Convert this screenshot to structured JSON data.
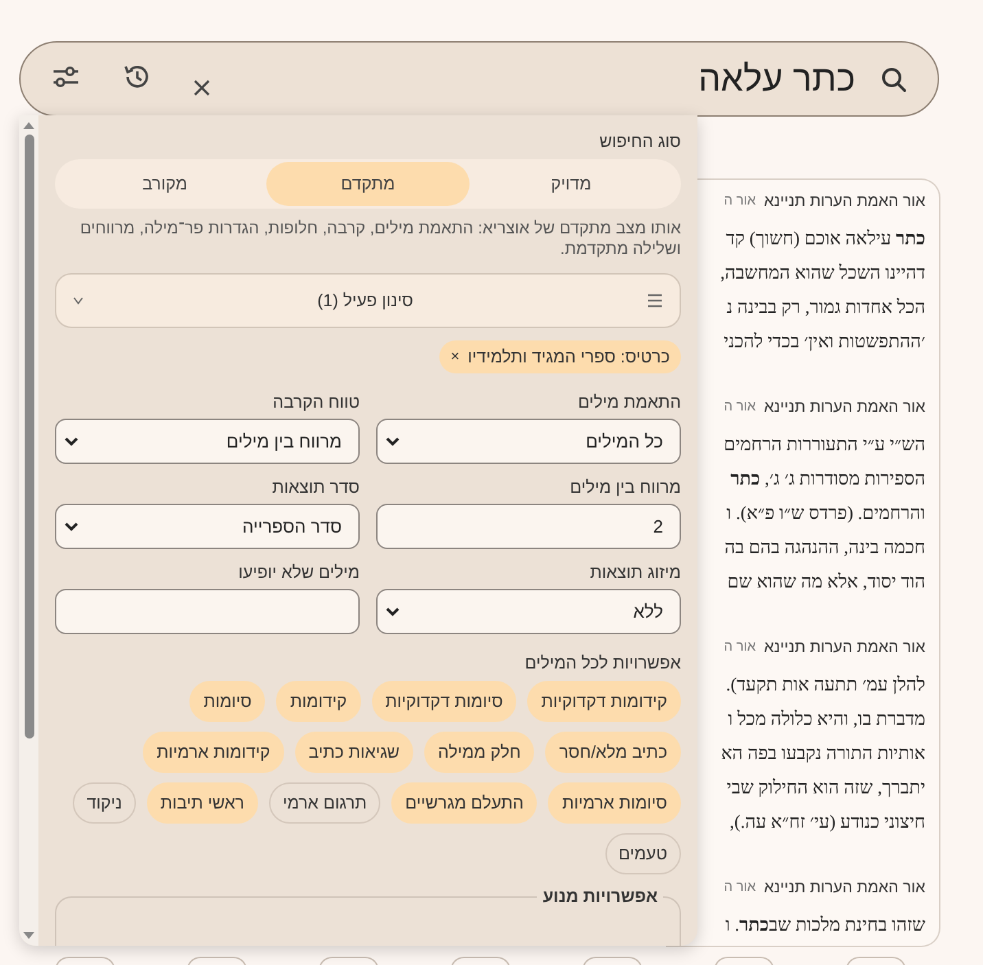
{
  "search": {
    "value": "כתר עלאה"
  },
  "panel": {
    "search_type_label": "סוג החיפוש",
    "search_types": [
      {
        "label": "מדויק",
        "selected": false
      },
      {
        "label": "מתקדם",
        "selected": true
      },
      {
        "label": "מקורב",
        "selected": false
      }
    ],
    "description": "אותו מצב מתקדם של אוצריא: התאמת מילים, קרבה, חלופות, הגדרות פר־מילה, מרווחים ושלילה מתקדמת.",
    "filter": {
      "label": "סינון פעיל (1)"
    },
    "active_filters": [
      {
        "label": "כרטיס: ספרי המגיד ותלמידיו",
        "remove": "×"
      }
    ],
    "fields": [
      {
        "kind": "select",
        "label": "התאמת מילים",
        "value": "כל המילים"
      },
      {
        "kind": "select",
        "label": "טווח הקרבה",
        "value": "מרווח בין מילים"
      },
      {
        "kind": "text",
        "label": "מרווח בין מילים",
        "value": "2"
      },
      {
        "kind": "select",
        "label": "סדר תוצאות",
        "value": "סדר הספרייה"
      },
      {
        "kind": "select",
        "label": "מיזוג תוצאות",
        "value": "ללא"
      },
      {
        "kind": "text",
        "label": "מילים שלא יופיעו"
      }
    ],
    "word_options_label": "אפשרויות לכל המילים",
    "word_options": [
      {
        "label": "קידומות דקדוקיות",
        "selected": true
      },
      {
        "label": "סיומות דקדוקיות",
        "selected": true
      },
      {
        "label": "קידומות",
        "selected": true
      },
      {
        "label": "סיומות",
        "selected": true
      },
      {
        "label": "כתיב מלא/חסר",
        "selected": true
      },
      {
        "label": "חלק ממילה",
        "selected": true
      },
      {
        "label": "שגיאות כתיב",
        "selected": true
      },
      {
        "label": "קידומות ארמיות",
        "selected": true
      },
      {
        "label": "סיומות ארמיות",
        "selected": true
      },
      {
        "label": "התעלם מגרשיים",
        "selected": true
      },
      {
        "label": "תרגום ארמי",
        "selected": false
      },
      {
        "label": "ראשי תיבות",
        "selected": true
      },
      {
        "label": "ניקוד",
        "selected": false
      },
      {
        "label": "טעמים",
        "selected": false
      }
    ],
    "engine_options_label": "אפשרויות מנוע"
  },
  "results": [
    {
      "source": "אור האמת הערות תניינא",
      "source_2": "אור ה",
      "lines": [
        "**כתר** עילאה אוכם (חשוך) קד",
        "דהיינו השכל שהוא המחשבה,",
        "הכל אחדות גמור, רק בבינה נ",
        "׳ההתפשטות ואין׳ בכדי להכני"
      ]
    },
    {
      "source": "אור האמת הערות תניינא",
      "source_2": "אור ה",
      "lines": [
        "הש״י ע״י התעוררות הרחמים",
        "הספירות מסודרות ג׳ ג׳, **כתר**",
        "והרחמים. (פרדס ש״ו פ״א). ו",
        "חכמה בינה, ההנהגה בהם בה",
        "הוד יסוד, אלא מה שהוא שם"
      ]
    },
    {
      "source": "אור האמת הערות תניינא",
      "source_2": "אור ה",
      "lines": [
        "להלן עמ׳ תתעה אות תקעד).",
        "מדברת בו, והיא כלולה מכל ו",
        "אותיות התורה נקבעו בפה הא",
        "יתברך, שזה הוא החילוק שבי",
        "חיצוני כנודע (עי׳ זח״א עה.),"
      ]
    },
    {
      "source": "אור האמת הערות תניינא",
      "source_2": "אור ה",
      "lines": [
        "שזהו בחינת מלכות שב**כתר**. ו"
      ]
    }
  ]
}
